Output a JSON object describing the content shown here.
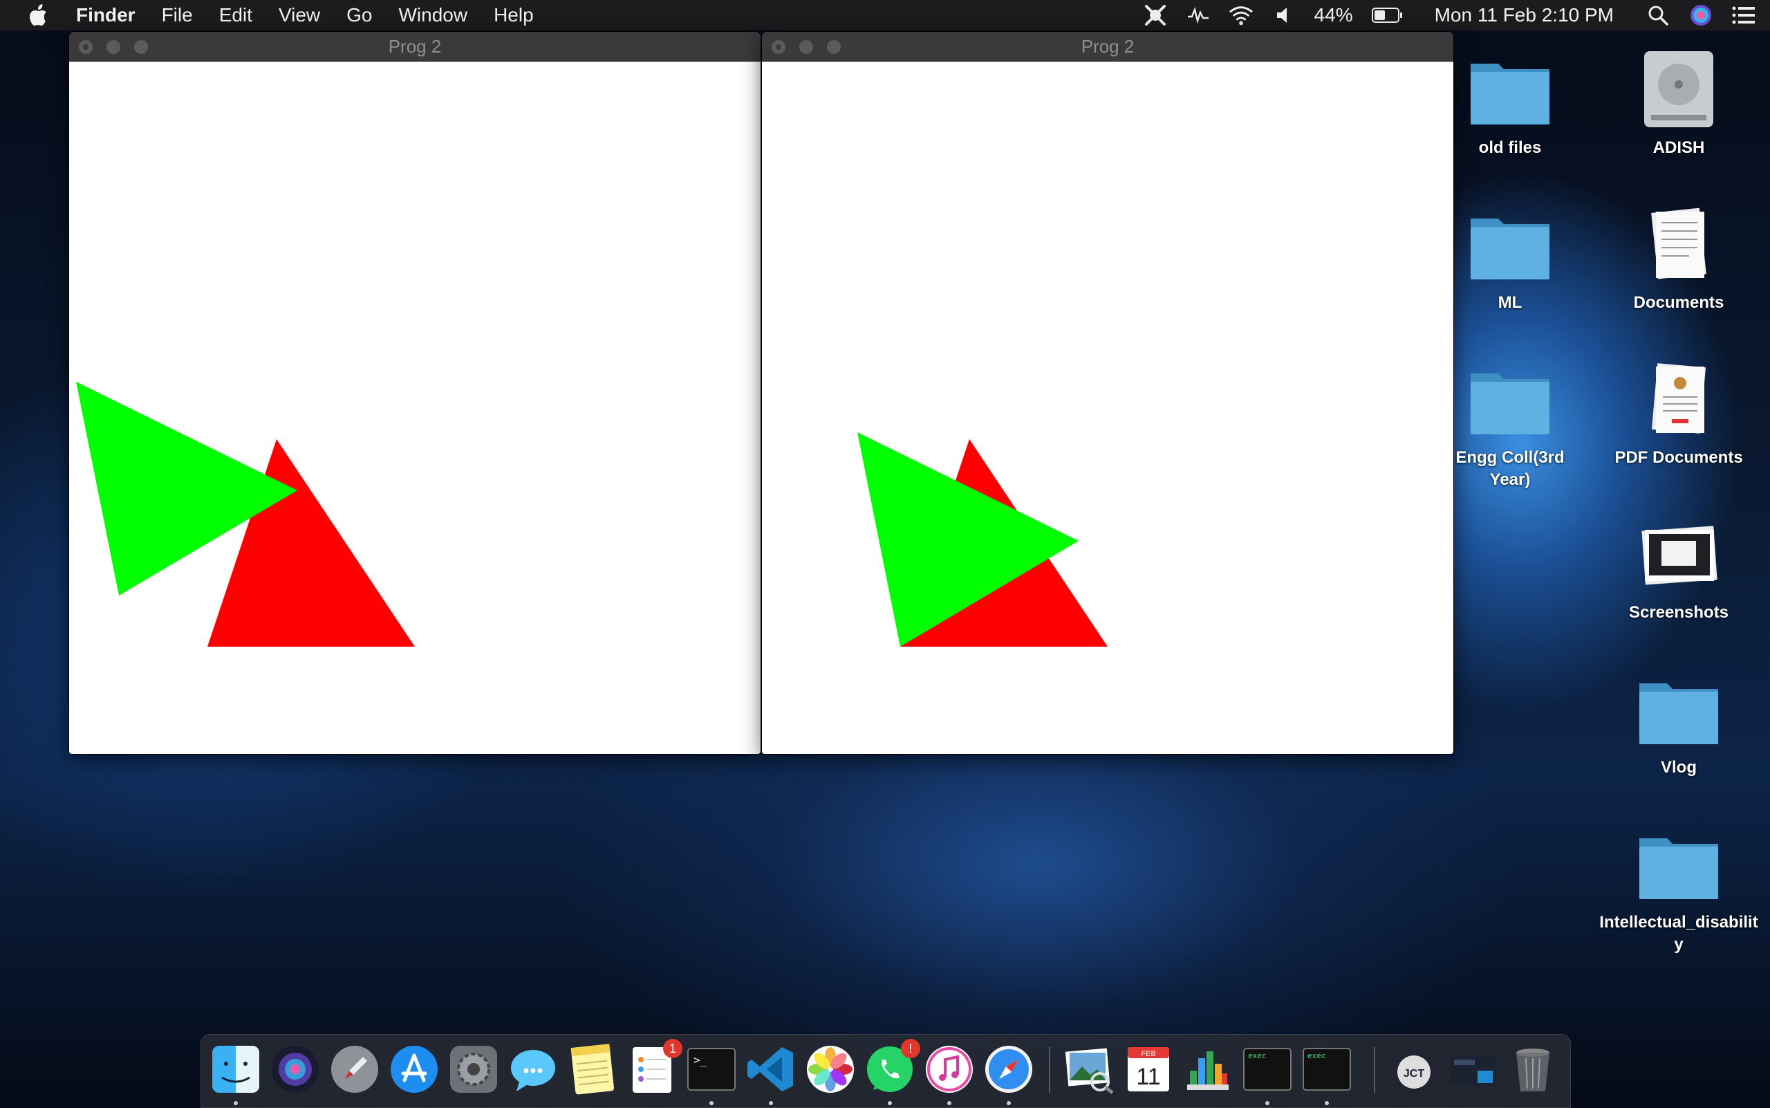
{
  "menubar": {
    "app_name": "Finder",
    "menus": [
      "File",
      "Edit",
      "View",
      "Go",
      "Window",
      "Help"
    ],
    "battery": "44%",
    "datetime": "Mon 11 Feb  2:10 PM"
  },
  "windows": [
    {
      "title": "Prog 2"
    },
    {
      "title": "Prog 2"
    }
  ],
  "shape_colors": {
    "green": "#00ff00",
    "red": "#ff0000"
  },
  "desktop": {
    "items": [
      {
        "label": "old files",
        "icon": "folder-icon"
      },
      {
        "label": "ADISH",
        "icon": "hard-drive-icon"
      },
      {
        "label": "ML",
        "icon": "folder-icon"
      },
      {
        "label": "Documents",
        "icon": "documents-icon"
      },
      {
        "label": "Engg Coll(3rd Year)",
        "icon": "folder-icon"
      },
      {
        "label": "PDF Documents",
        "icon": "pdf-documents-icon"
      },
      {
        "label": "Screenshots",
        "icon": "screenshots-icon"
      },
      {
        "label": "Vlog",
        "icon": "folder-icon"
      },
      {
        "label": "Intellectual_disability",
        "icon": "folder-icon"
      }
    ]
  },
  "dock": {
    "reminders_badge": "1",
    "whatsapp_badge": "!",
    "calendar_month": "FEB",
    "calendar_day": "11",
    "exec_label": "exec",
    "jct_label": "JCT"
  }
}
